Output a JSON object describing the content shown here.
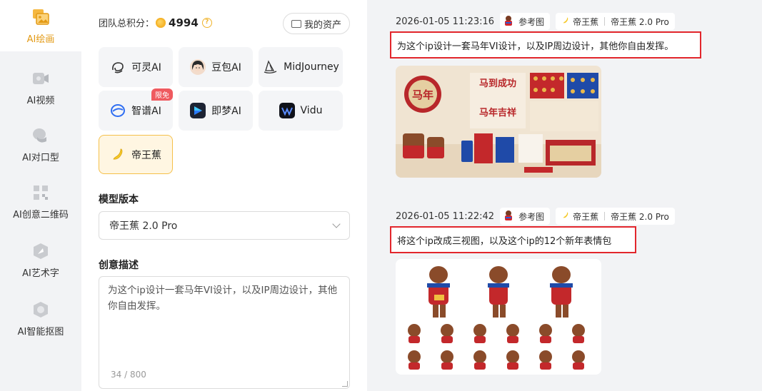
{
  "nav": {
    "items": [
      {
        "label": "AI绘画",
        "icon": "image-icon",
        "active": true
      },
      {
        "label": "AI视频",
        "icon": "video-icon",
        "active": false
      },
      {
        "label": "AI对口型",
        "icon": "lip-sync-icon",
        "active": false
      },
      {
        "label": "AI创意二维码",
        "icon": "qrcode-icon",
        "active": false
      },
      {
        "label": "AI艺术字",
        "icon": "art-text-icon",
        "active": false
      },
      {
        "label": "AI智能抠图",
        "icon": "cutout-icon",
        "active": false
      }
    ]
  },
  "panel": {
    "score_label": "团队总积分：",
    "score_value": "4994",
    "assets_label": "我的资产",
    "models": [
      {
        "label": "可灵AI",
        "icon": "kling-icon"
      },
      {
        "label": "豆包AI",
        "icon": "doubao-avatar-icon"
      },
      {
        "label": "MidJourney",
        "icon": "midjourney-sail-icon"
      },
      {
        "label": "智谱AI",
        "icon": "zhipu-icon",
        "badge": "限免"
      },
      {
        "label": "即梦AI",
        "icon": "jimeng-icon"
      },
      {
        "label": "Vidu",
        "icon": "vidu-icon"
      },
      {
        "label": "帝王蕉",
        "icon": "banana-icon",
        "selected": true
      }
    ],
    "version_title": "模型版本",
    "version_value": "帝王蕉 2.0 Pro",
    "desc_title": "创意描述",
    "desc_value": "为这个ip设计一套马年VI设计，以及IP周边设计，其他你自由发挥。",
    "desc_counter": "34 / 800"
  },
  "feed": {
    "messages": [
      {
        "time": "2026-01-05 11:23:16",
        "ref_label": "参考图",
        "model_name": "帝王蕉",
        "model_version": "帝王蕉 2.0 Pro",
        "prompt": "为这个ip设计一套马年VI设计，以及IP周边设计，其他你自由发挥。",
        "image": {
          "alt": "马年VI设计",
          "texts": [
            "马年",
            "马到成功",
            "马年吉祥"
          ]
        }
      },
      {
        "time": "2026-01-05 11:22:42",
        "ref_label": "参考图",
        "model_name": "帝王蕉",
        "model_version": "帝王蕉 2.0 Pro",
        "prompt": "将这个ip改成三视图，以及这个ip的12个新年表情包",
        "image": {
          "alt": "三视图与表情包"
        }
      }
    ]
  },
  "colors": {
    "accent": "#e39a15",
    "highlight_border": "#e2262c",
    "selected_bg": "#fff6e2"
  }
}
